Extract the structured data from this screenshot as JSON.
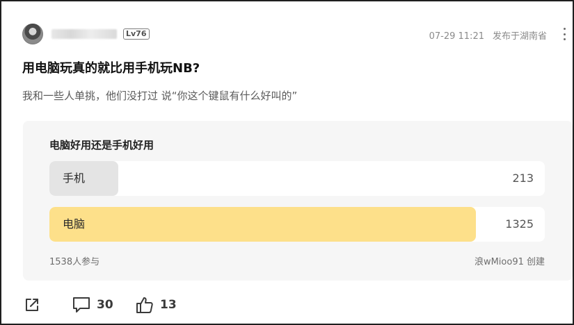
{
  "post": {
    "level": "Lv76",
    "date": "07-29 11:21",
    "location": "发布于湖南省",
    "title": "用电脑玩真的就比用手机玩NB?",
    "body": "我和一些人单挑，他们没打过 说“你这个键鼠有什么好叫的”"
  },
  "poll": {
    "title": "电脑好用还是手机好用",
    "options": [
      {
        "label": "手机",
        "count": "213",
        "share": 0.1385,
        "color": "#e4e4e4"
      },
      {
        "label": "电脑",
        "count": "1325",
        "share": 0.8615,
        "color": "#fde08a"
      }
    ],
    "participants": "1538人参与",
    "creator": "浪wMioo91 创建"
  },
  "actions": {
    "comment_count": "30",
    "like_count": "13"
  },
  "icons": [
    "share-icon",
    "comment-icon",
    "thumbs-up-icon",
    "more-icon",
    "avatar"
  ]
}
